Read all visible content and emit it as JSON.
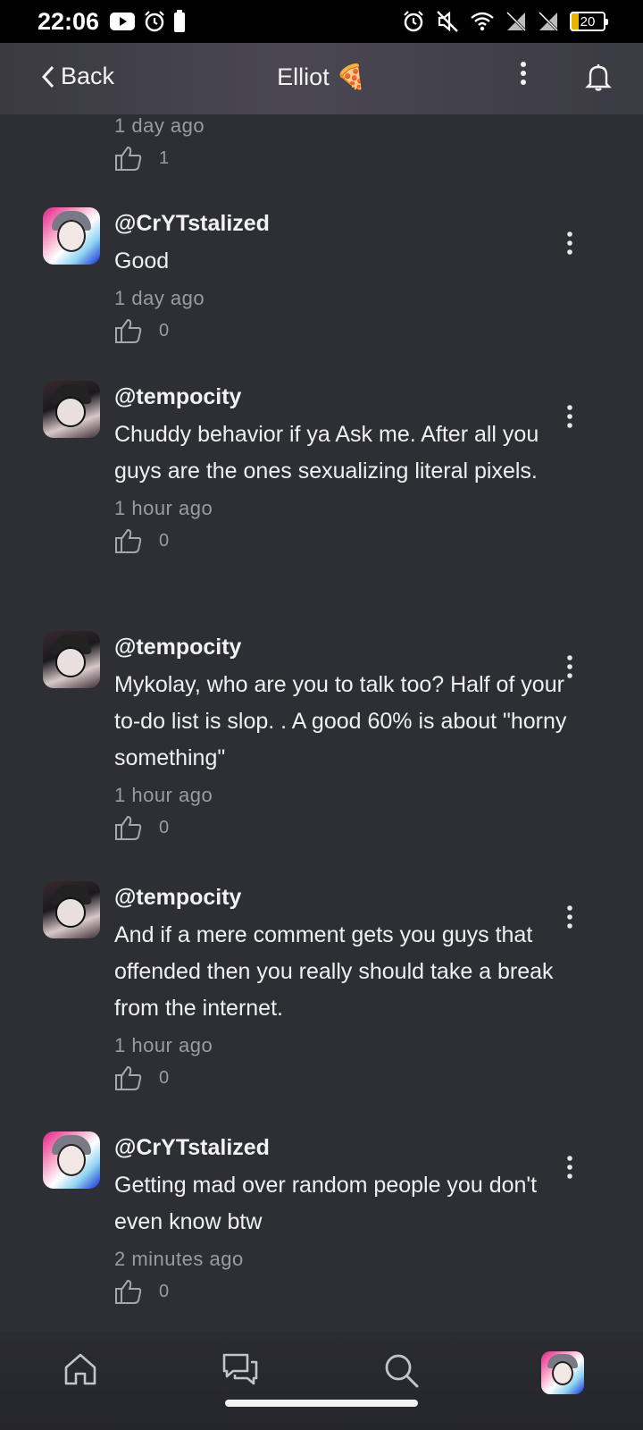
{
  "status": {
    "time": "22:06",
    "battery": "20",
    "left_icons": [
      "youtube-icon",
      "alarm-icon",
      "battery-alt-icon"
    ],
    "right_icons": [
      "alarm-icon",
      "mute-icon",
      "wifi-icon",
      "no-signal-icon",
      "no-signal-icon",
      "battery-icon"
    ]
  },
  "header": {
    "back_label": "Back",
    "title": "Elliot 🍕"
  },
  "top_partial": {
    "time": "1 day ago",
    "likes": "1"
  },
  "comments": [
    {
      "user": "@CrYTstalized",
      "avatar": "cry",
      "text": "Good",
      "time": "1 day ago",
      "likes": "0"
    },
    {
      "user": "@tempocity",
      "avatar": "tempo",
      "text": "Chuddy behavior if ya Ask me. After all you guys are the ones sexualizing literal pixels.",
      "time": "1 hour ago",
      "likes": "0"
    },
    {
      "user": "@tempocity",
      "avatar": "tempo",
      "text": "Mykolay, who are you to talk too? Half of your to-do list is slop. . A good 60% is about \"horny something\"",
      "time": "1 hour ago",
      "likes": "0"
    },
    {
      "user": "@tempocity",
      "avatar": "tempo",
      "text": "And if a mere comment gets you guys that offended then you really should take a break from the internet.",
      "time": "1 hour ago",
      "likes": "0"
    },
    {
      "user": "@CrYTstalized",
      "avatar": "cry",
      "text": "Getting mad over random people you don't even know btw",
      "time": "2 minutes ago",
      "likes": "0"
    }
  ],
  "bottom_nav": [
    "home-icon",
    "chat-icon",
    "search-icon",
    "profile-avatar"
  ],
  "colors": {
    "background": "#2e2f34",
    "text": "#f0f0f2",
    "muted": "#9a9ba3",
    "battery_fill": "#e7b500"
  }
}
